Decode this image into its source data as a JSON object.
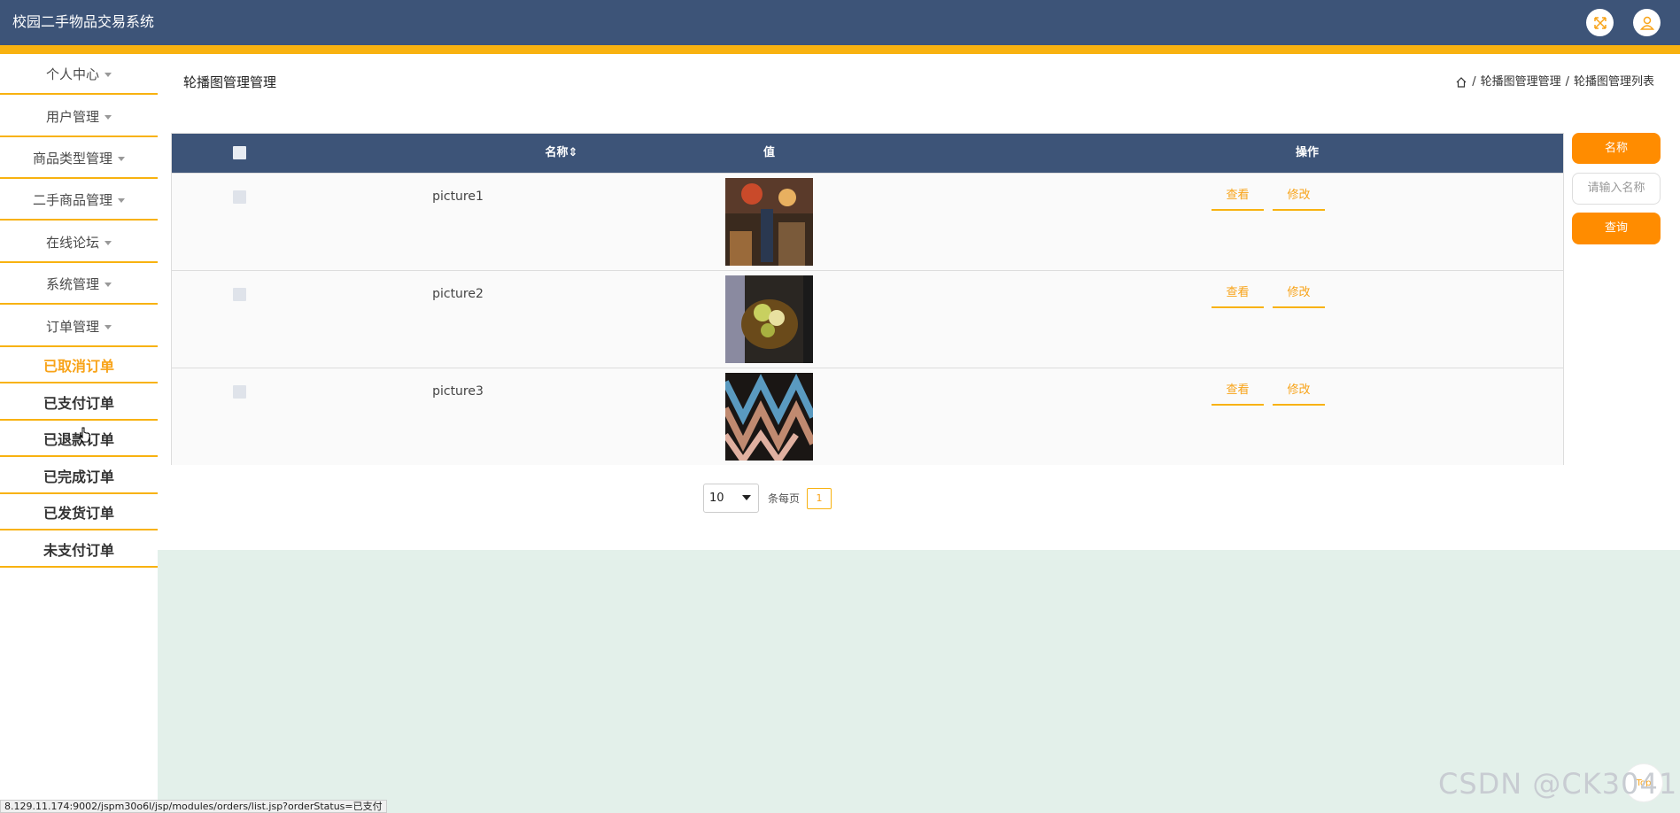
{
  "app": {
    "title": "校园二手物品交易系统"
  },
  "header": {
    "fullscreen_icon": "fullscreen-icon",
    "user_icon": "user-icon"
  },
  "sidebar": {
    "menus": [
      {
        "label": "个人中心"
      },
      {
        "label": "用户管理"
      },
      {
        "label": "商品类型管理"
      },
      {
        "label": "二手商品管理"
      },
      {
        "label": "在线论坛"
      },
      {
        "label": "系统管理"
      },
      {
        "label": "订单管理"
      }
    ],
    "order_items": [
      {
        "label": "已取消订单",
        "active": true
      },
      {
        "label": "已支付订单",
        "active": false
      },
      {
        "label": "已退款订单",
        "active": false
      },
      {
        "label": "已完成订单",
        "active": false
      },
      {
        "label": "已发货订单",
        "active": false
      },
      {
        "label": "未支付订单",
        "active": false
      }
    ]
  },
  "page": {
    "title": "轮播图管理管理",
    "breadcrumb": {
      "level1": "轮播图管理管理",
      "level2": "轮播图管理列表"
    }
  },
  "table": {
    "columns": {
      "name": "名称",
      "value": "值",
      "actions": "操作"
    },
    "rows": [
      {
        "name": "picture1",
        "view": "查看",
        "edit": "修改"
      },
      {
        "name": "picture2",
        "view": "查看",
        "edit": "修改"
      },
      {
        "name": "picture3",
        "view": "查看",
        "edit": "修改"
      }
    ]
  },
  "pagination": {
    "page_size": "10",
    "per_page_label": "条每页",
    "current_page": "1"
  },
  "search": {
    "label": "名称",
    "placeholder": "请输入名称",
    "button": "查询"
  },
  "status_url": "8.129.11.174:9002/jspm30o6l/jsp/modules/orders/list.jsp?orderStatus=已支付",
  "watermark": "CSDN @CK3041",
  "float_button": "Top",
  "colors": {
    "header": "#3d5478",
    "accent": "#f8b210",
    "button": "#ff8c00",
    "content_bg": "#e3f0ea"
  }
}
